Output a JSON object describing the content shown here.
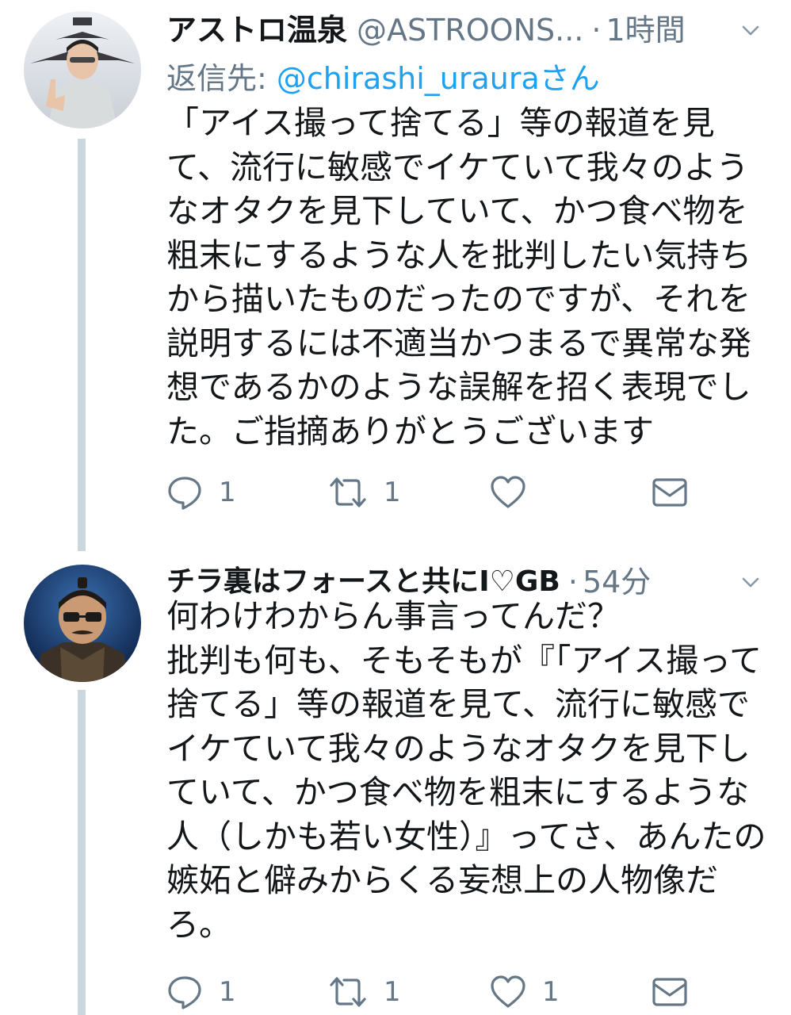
{
  "tweets": [
    {
      "display_name": "アストロ温泉",
      "handle": "@ASTROONS...",
      "separator": "·",
      "time": "1時間",
      "reply_prefix": "返信先: ",
      "reply_mention": "@chirashi_uraura",
      "reply_suffix": "さん",
      "text": "「アイス撮って捨てる」等の報道を見て、流行に敏感でイケていて我々のようなオタクを見下していて、かつ食べ物を粗末にするような人を批判したい気持ちから描いたものだったのですが、それを説明するには不適当かつまるで異常な発想であるかのような誤解を招く表現でした。ご指摘ありがとうございます",
      "actions": {
        "reply_count": "1",
        "retweet_count": "1",
        "like_count": ""
      },
      "avatar_icon": "person-avatar-icon"
    },
    {
      "display_name": "チラ裏はフォースと共にI♡GB",
      "handle": "",
      "separator": "·",
      "time": "54分",
      "text": "何わけわからん事言ってんだ？\n批判も何も、そもそもが『「アイス撮って捨てる」等の報道を見て、流行に敏感でイケていて我々のようなオタクを見下していて、かつ食べ物を粗末にするような人（しかも若い女性）』ってさ、あんたの嫉妬と僻みからくる妄想上の人物像だろ。",
      "actions": {
        "reply_count": "1",
        "retweet_count": "1",
        "like_count": "1"
      },
      "avatar_icon": "samurai-avatar-icon"
    }
  ],
  "icons": {
    "reply": "reply-icon",
    "retweet": "retweet-icon",
    "like": "heart-icon",
    "dm": "envelope-icon",
    "menu": "chevron-down-icon"
  },
  "colors": {
    "text": "#14171a",
    "secondary": "#657786",
    "link": "#1da1f2",
    "thread_line": "#ccd6dd"
  }
}
